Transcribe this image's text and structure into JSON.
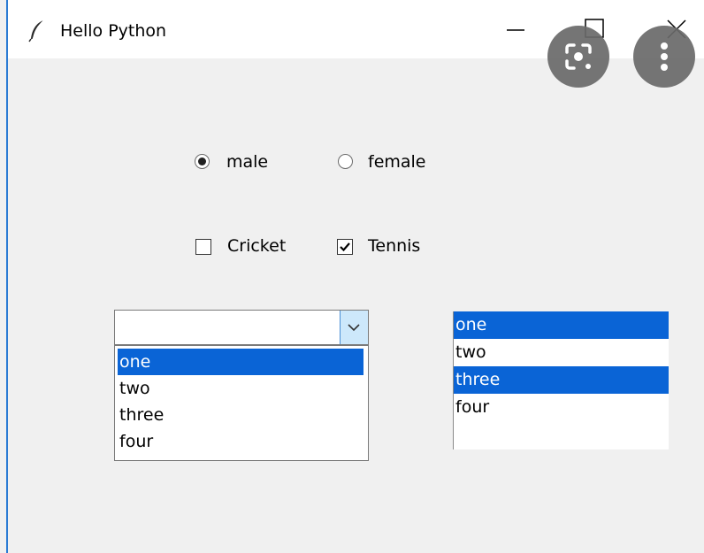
{
  "window": {
    "title": "Hello Python"
  },
  "gender": {
    "options": [
      {
        "label": "male",
        "selected": true
      },
      {
        "label": "female",
        "selected": false
      }
    ]
  },
  "sports": {
    "options": [
      {
        "label": "Cricket",
        "checked": false
      },
      {
        "label": "Tennis",
        "checked": true
      }
    ]
  },
  "combobox": {
    "value": "",
    "items": [
      "one",
      "two",
      "three",
      "four"
    ],
    "highlighted": "one"
  },
  "listbox": {
    "items": [
      "one",
      "two",
      "three",
      "four"
    ],
    "selected": [
      "one",
      "three"
    ]
  },
  "colors": {
    "selection": "#0a64d6",
    "window_bg": "#f0f0f0",
    "titlebar_bg": "#ffffff",
    "accent_border": "#2b7bd4"
  },
  "icons": {
    "app": "feather-icon",
    "minimize": "minimize-icon",
    "maximize": "maximize-icon",
    "close": "close-icon",
    "overlay_left": "lens-scan-icon",
    "overlay_right": "more-vertical-icon",
    "combo_arrow": "chevron-down-icon"
  }
}
